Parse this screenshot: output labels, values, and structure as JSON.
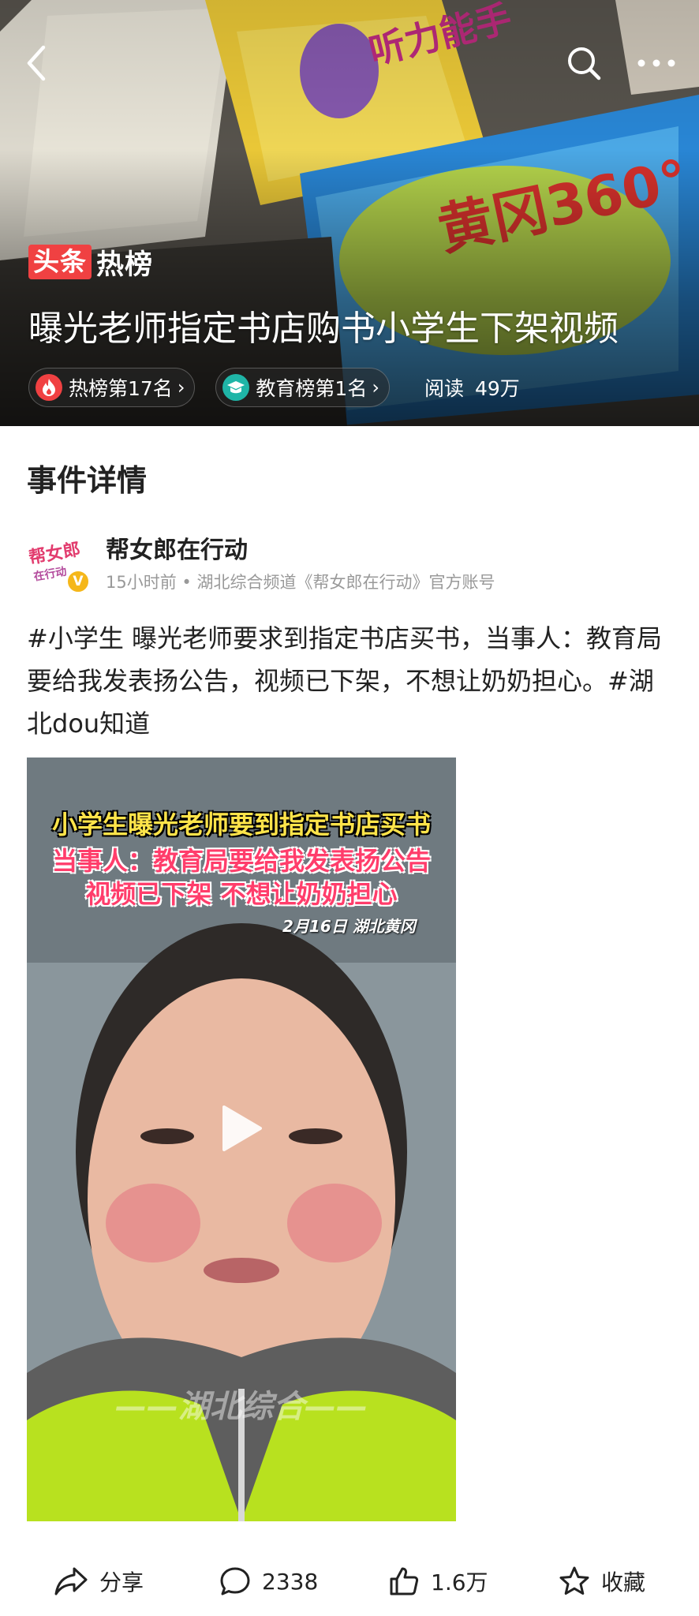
{
  "header": {
    "brand_box": "头条",
    "brand_text": "热榜",
    "title": "曝光老师指定书店购书小学生下架视频",
    "chips": [
      {
        "label": "热榜第17名",
        "icon": "flame-icon",
        "color": "#f04142"
      },
      {
        "label": "教育榜第1名",
        "icon": "education-cap-icon",
        "color": "#1fb5a7"
      }
    ],
    "read_label": "阅读",
    "read_count": "49万",
    "icons": {
      "back": "back-arrow-icon",
      "search": "search-icon",
      "more": "more-icon"
    }
  },
  "section": {
    "title": "事件详情"
  },
  "author": {
    "name": "帮女郎在行动",
    "badge": "V",
    "meta": "15小时前 • 湖北综合频道《帮女郎在行动》官方账号",
    "avatar_text": "帮女郎"
  },
  "post": {
    "tag1": "#小学生",
    "body": " 曝光老师要求到指定书店买书，当事人：教育局要给我发表扬公告，视频已下架，不想让奶奶担心。",
    "tag2": "#湖北dou知道"
  },
  "video": {
    "caption_line1": "小学生曝光老师要到指定书店买书",
    "caption_line2": "当事人：教育局要给我发表扬公告",
    "caption_line3": "视频已下架 不想让奶奶担心",
    "date_location": "2月16日 湖北黄冈",
    "watermark": "——湖北综合——"
  },
  "actions": {
    "share": "分享",
    "comments": "2338",
    "likes": "1.6万",
    "collect": "收藏"
  },
  "colors": {
    "brand_red": "#f04142",
    "edu_teal": "#1fb5a7",
    "meta_gray": "#999999",
    "verified_yellow": "#f5b71a"
  }
}
